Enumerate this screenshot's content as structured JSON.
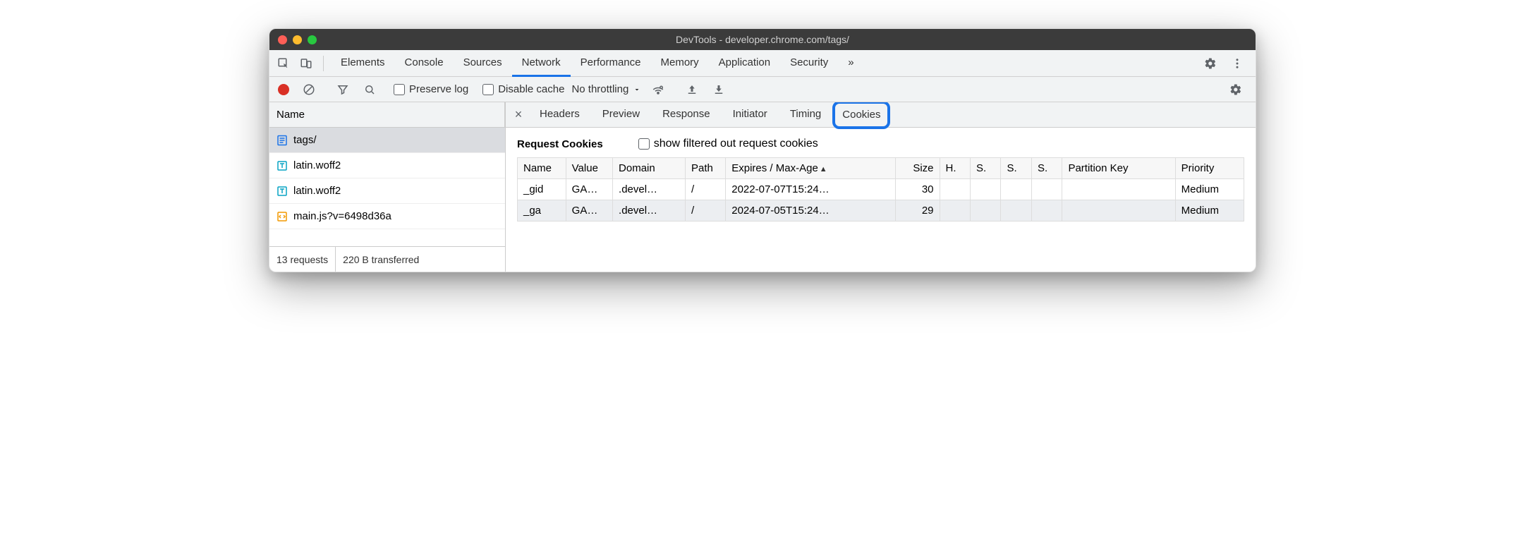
{
  "window": {
    "title": "DevTools - developer.chrome.com/tags/"
  },
  "tabs": {
    "items": [
      "Elements",
      "Console",
      "Sources",
      "Network",
      "Performance",
      "Memory",
      "Application",
      "Security"
    ],
    "active": "Network",
    "overflow": "»"
  },
  "netbar": {
    "preserve_log": "Preserve log",
    "disable_cache": "Disable cache",
    "throttling": "No throttling"
  },
  "left": {
    "header": "Name",
    "items": [
      {
        "name": "tags/",
        "type": "doc",
        "selected": true
      },
      {
        "name": "latin.woff2",
        "type": "font"
      },
      {
        "name": "latin.woff2",
        "type": "font"
      },
      {
        "name": "main.js?v=6498d36a",
        "type": "js"
      }
    ],
    "status": {
      "requests": "13 requests",
      "transferred": "220 B transferred"
    }
  },
  "detail": {
    "tabs": [
      "Headers",
      "Preview",
      "Response",
      "Initiator",
      "Timing",
      "Cookies"
    ],
    "active": "Cookies",
    "section_title": "Request Cookies",
    "show_filtered_label": "show filtered out request cookies",
    "cols": [
      "Name",
      "Value",
      "Domain",
      "Path",
      "Expires / Max-Age",
      "Size",
      "H.",
      "S.",
      "S.",
      "S.",
      "Partition Key",
      "Priority"
    ],
    "rows": [
      {
        "name": "_gid",
        "value": "GA…",
        "domain": ".devel…",
        "path": "/",
        "expires": "2022-07-07T15:24…",
        "size": "30",
        "h": "",
        "s1": "",
        "s2": "",
        "s3": "",
        "pkey": "",
        "priority": "Medium"
      },
      {
        "name": "_ga",
        "value": "GA…",
        "domain": ".devel…",
        "path": "/",
        "expires": "2024-07-05T15:24…",
        "size": "29",
        "h": "",
        "s1": "",
        "s2": "",
        "s3": "",
        "pkey": "",
        "priority": "Medium"
      }
    ]
  }
}
